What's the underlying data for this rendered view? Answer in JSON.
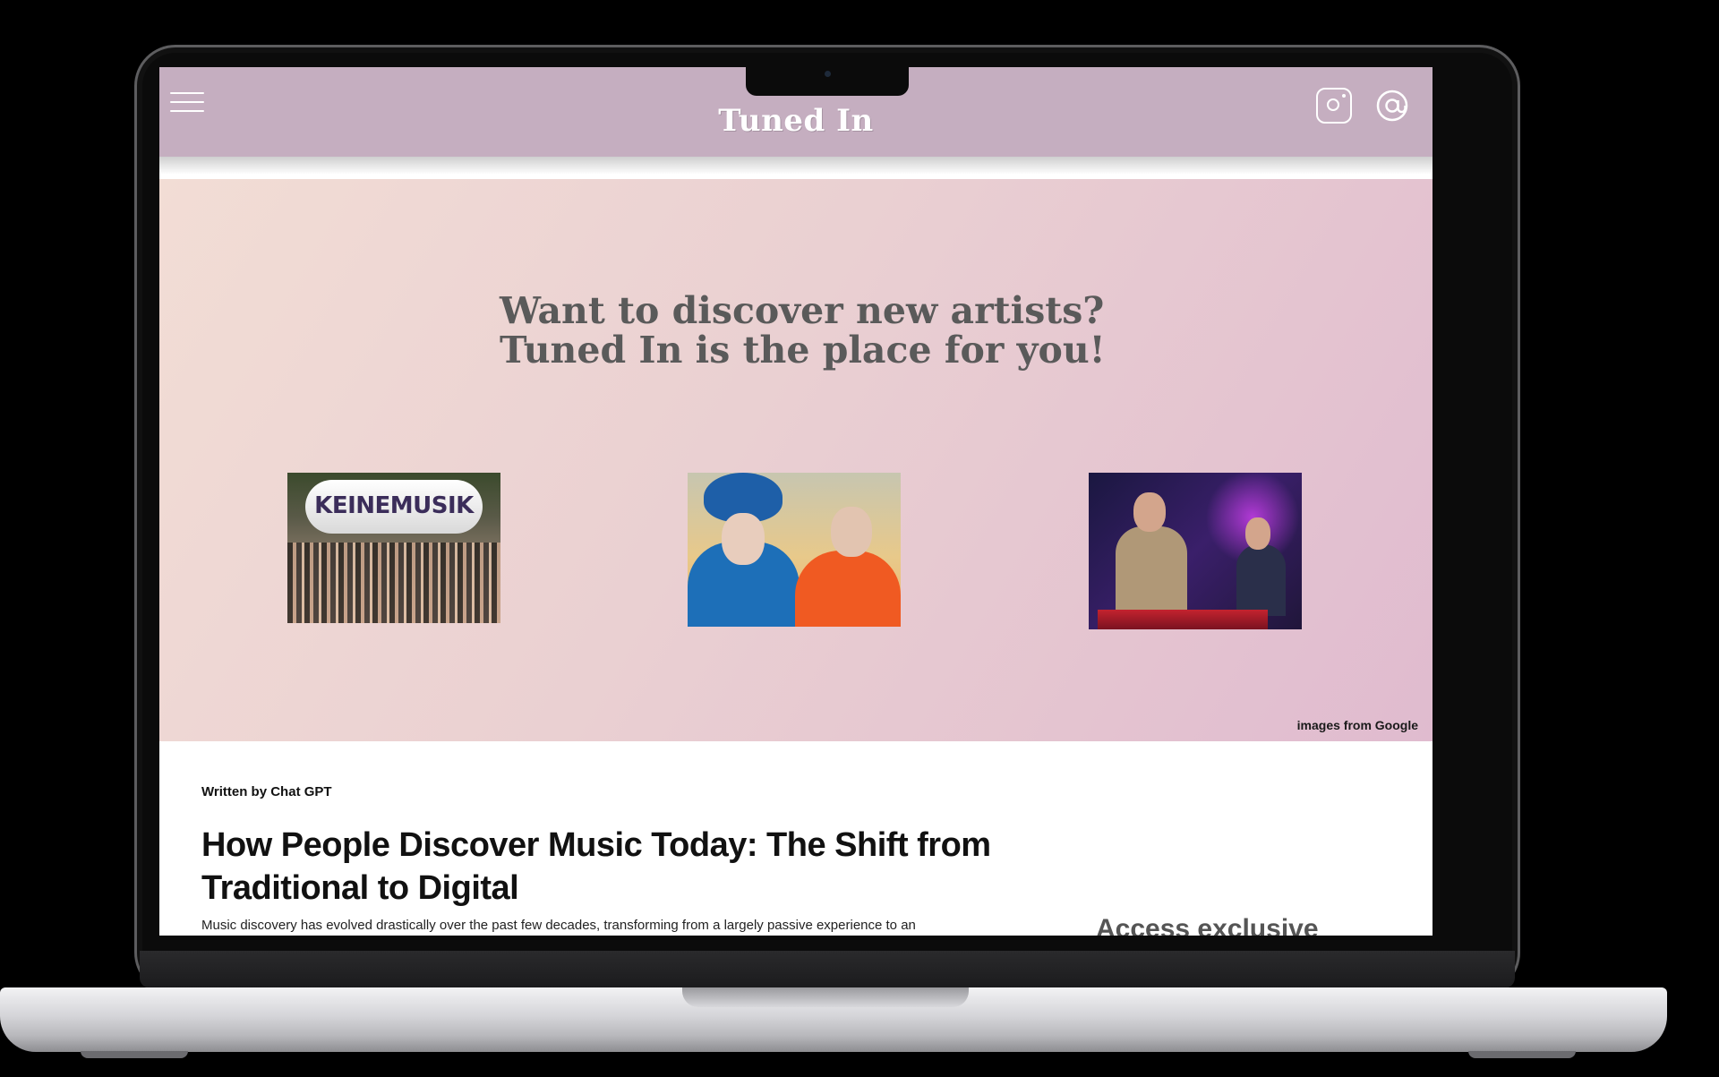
{
  "header": {
    "logo": "Tuned In"
  },
  "hero": {
    "title_line1": "Want to discover new artists?",
    "title_line2": "Tuned In is the place for you!",
    "thumbnails": [
      {
        "caption": "KEINEMUSIK"
      },
      {
        "caption": ""
      },
      {
        "caption": ""
      }
    ],
    "credit": "images from Google"
  },
  "article": {
    "byline": "Written by Chat GPT",
    "title": "How People Discover Music Today: The Shift from Traditional to Digital",
    "body": "Music discovery has evolved drastically over the past few decades, transforming from a largely passive experience to an"
  },
  "sidebar": {
    "heading": "Access exclusive"
  },
  "icons": {
    "menu": "hamburger-menu-icon",
    "instagram": "instagram-icon",
    "email": "at-sign-icon"
  },
  "colors": {
    "header": "#c5aec0",
    "hero_start": "#f2ddd5",
    "hero_end": "#e0bbcf",
    "hero_text": "#5a5a5a"
  }
}
